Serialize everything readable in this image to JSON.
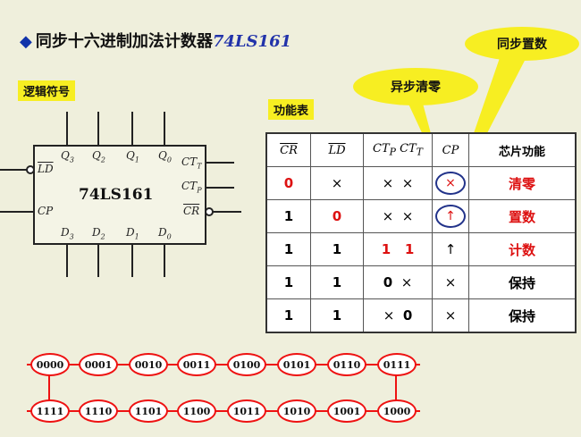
{
  "title": {
    "text": "同步十六进制加法计数器",
    "chip": "74LS161"
  },
  "labels": {
    "symbol": "逻辑符号",
    "table": "功能表"
  },
  "bubbles": {
    "async_clear": "异步清零",
    "sync_load": "同步置数"
  },
  "chip": {
    "name": "74LS161",
    "pins_top": [
      {
        "base": "Q",
        "sub": "3"
      },
      {
        "base": "Q",
        "sub": "2"
      },
      {
        "base": "Q",
        "sub": "1"
      },
      {
        "base": "Q",
        "sub": "0"
      }
    ],
    "pins_bottom": [
      {
        "base": "D",
        "sub": "3"
      },
      {
        "base": "D",
        "sub": "2"
      },
      {
        "base": "D",
        "sub": "1"
      },
      {
        "base": "D",
        "sub": "0"
      }
    ],
    "pin_ld": "LD",
    "pin_cp": "CP",
    "pin_ctt": {
      "base": "CT",
      "sub": "T"
    },
    "pin_ctp": {
      "base": "CT",
      "sub": "P"
    },
    "pin_cr": "CR"
  },
  "table": {
    "headers": {
      "cr": "CR",
      "ld": "LD",
      "ctp": {
        "base": "CT",
        "sub": "P"
      },
      "ctt": {
        "base": "CT",
        "sub": "T"
      },
      "cp": "CP",
      "func": "芯片功能"
    },
    "rows": [
      {
        "cr": "0",
        "ld": "×",
        "ctp": "×",
        "ctt": "×",
        "cp": "×",
        "func": "清零"
      },
      {
        "cr": "1",
        "ld": "0",
        "ctp": "×",
        "ctt": "×",
        "cp": "↑",
        "func": "置数"
      },
      {
        "cr": "1",
        "ld": "1",
        "ctp": "1",
        "ctt": "1",
        "cp": "↑",
        "func": "计数"
      },
      {
        "cr": "1",
        "ld": "1",
        "ctp": "0",
        "ctt": "×",
        "cp": "×",
        "func": "保持"
      },
      {
        "cr": "1",
        "ld": "1",
        "ctp": "×",
        "ctt": "0",
        "cp": "×",
        "func": "保持"
      }
    ]
  },
  "states_top": [
    "0000",
    "0001",
    "0010",
    "0011",
    "0100",
    "0101",
    "0110",
    "0111"
  ],
  "states_bottom": [
    "1111",
    "1110",
    "1101",
    "1100",
    "1011",
    "1010",
    "1001",
    "1000"
  ],
  "colors": {
    "accent_red": "#dd1111",
    "highlight_yellow": "#f7ee22",
    "title_blue": "#2233aa"
  }
}
